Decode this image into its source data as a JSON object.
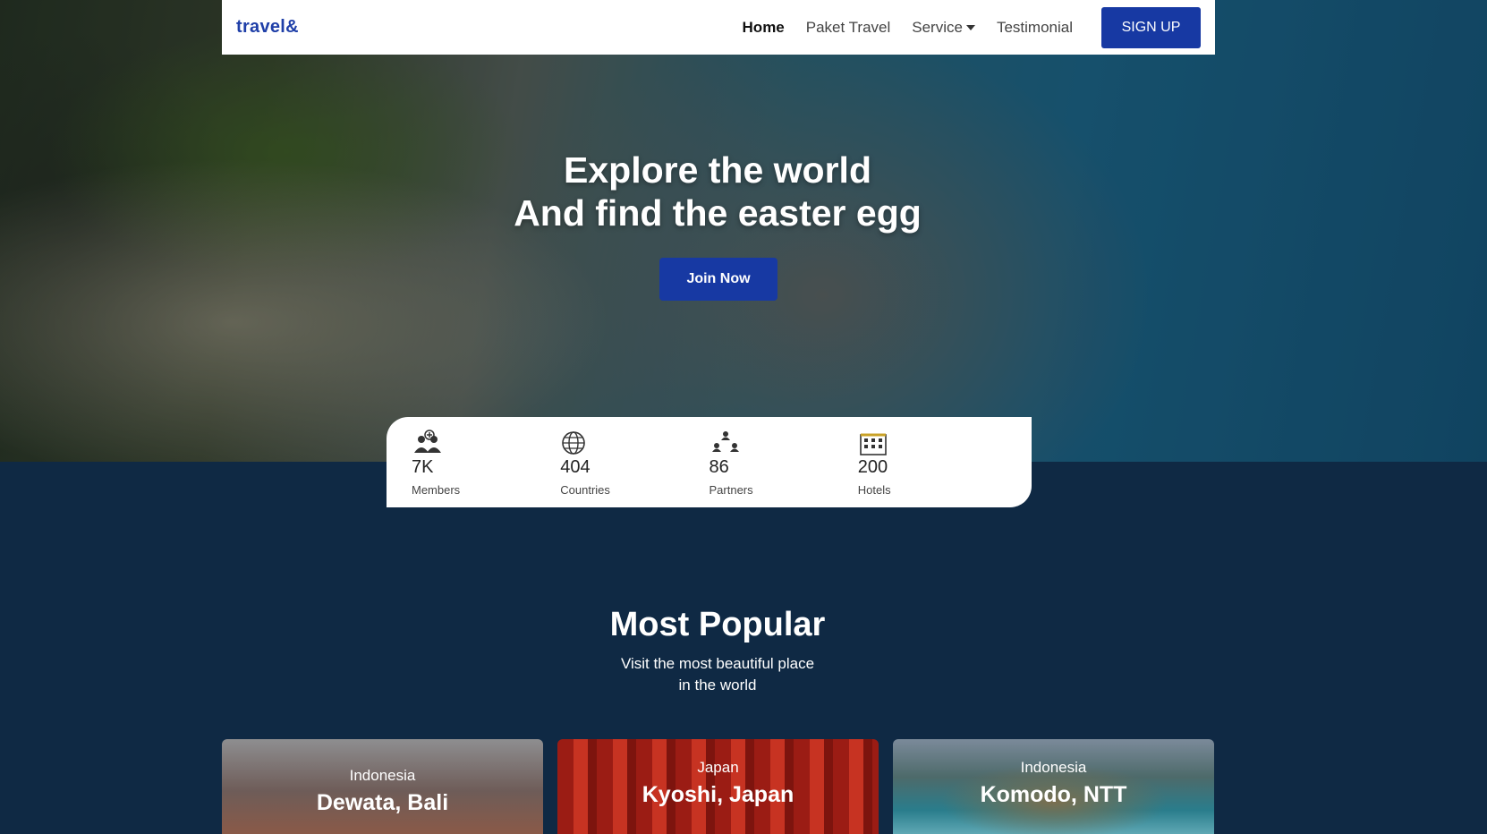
{
  "nav": {
    "logo": "travel&",
    "links": [
      "Home",
      "Paket Travel",
      "Service",
      "Testimonial"
    ],
    "signup": "SIGN UP"
  },
  "hero": {
    "title_line1": "Explore the world",
    "title_line2": "And find the easter egg",
    "cta": "Join Now"
  },
  "stats": [
    {
      "icon": "members-icon",
      "value": "7K",
      "label": "Members"
    },
    {
      "icon": "globe-icon",
      "value": "404",
      "label": "Countries"
    },
    {
      "icon": "partners-icon",
      "value": "86",
      "label": "Partners"
    },
    {
      "icon": "hotel-icon",
      "value": "200",
      "label": "Hotels"
    }
  ],
  "popular": {
    "title": "Most Popular",
    "subtitle_line1": "Visit the most beautiful place",
    "subtitle_line2": "in the world",
    "cards": [
      {
        "country": "Indonesia",
        "place": "Dewata, Bali"
      },
      {
        "country": "Japan",
        "place": "Kyoshi, Japan"
      },
      {
        "country": "Indonesia",
        "place": "Komodo, NTT"
      }
    ]
  },
  "colors": {
    "brand": "#1739a3",
    "background": "#0f2944",
    "logo": "#1f3fa8"
  }
}
